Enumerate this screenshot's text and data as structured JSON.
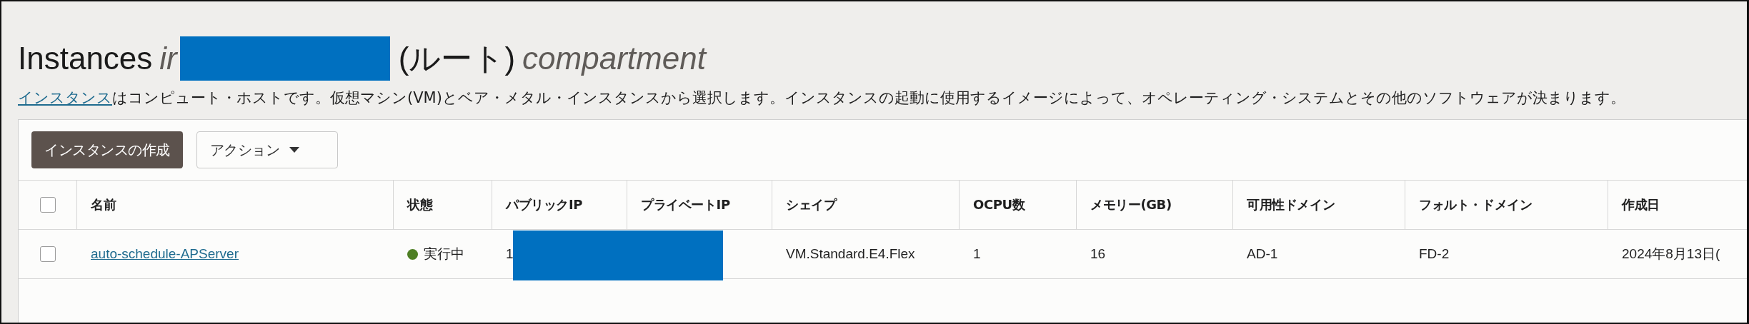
{
  "title": [
    {
      "kind": "plain",
      "text": "Instances"
    },
    {
      "kind": "italic",
      "text": "ir"
    },
    {
      "kind": "redaction"
    },
    {
      "kind": "plain",
      "text": "(ルート)"
    },
    {
      "kind": "italic",
      "text": "compartment"
    }
  ],
  "description": {
    "link": "インスタンス",
    "text": "はコンピュート・ホストです。仮想マシン(VM)とベア・メタル・インスタンスから選択します。インスタンスの起動に使用するイメージによって、オペレーティング・システムとその他のソフトウェアが決まります。"
  },
  "toolbar": {
    "create_button": "インスタンスの作成",
    "actions_menu": "アクション"
  },
  "table": {
    "select_all_checked": false,
    "columns": [
      "名前",
      "状態",
      "パブリックIP",
      "プライベートIP",
      "シェイプ",
      "OCPU数",
      "メモリー(GB)",
      "可用性ドメイン",
      "フォルト・ドメイン",
      "作成日"
    ],
    "rows": [
      {
        "checked": false,
        "name": "auto-schedule-APServer",
        "state": "実行中",
        "color": "#4e7f24",
        "public_ip": "1",
        "ip_redacted": true,
        "shape": "VM.Standard.E4.Flex",
        "ocpu": "1",
        "memory": "16",
        "availability_domain": "AD-1",
        "fault_domain": "FD-2",
        "created": "2024年8月13日("
      }
    ]
  }
}
